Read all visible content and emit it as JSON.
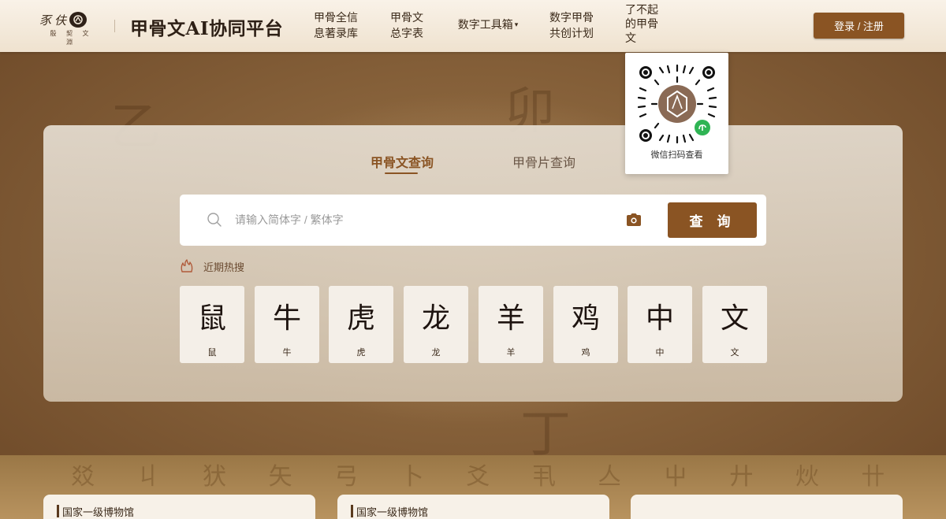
{
  "logo": {
    "chars": [
      "豕",
      "伕"
    ],
    "subtitle": "殷 契 文 淵"
  },
  "header": {
    "site_title": "甲骨文AI协同平台",
    "nav": [
      {
        "line1": "甲骨全信",
        "line2": "息著录库"
      },
      {
        "line1": "甲骨文",
        "line2": "总字表"
      },
      {
        "label": "数字工具箱",
        "caret": "▾"
      },
      {
        "line1": "数字甲骨",
        "line2": "共创计划"
      },
      {
        "line1": "了不起",
        "line2": "的甲骨",
        "line3": "文"
      }
    ],
    "login_label": "登录 / 注册"
  },
  "qr_popover": {
    "caption": "微信扫码查看"
  },
  "search": {
    "tabs": [
      {
        "label": "甲骨文查询",
        "active": true
      },
      {
        "label": "甲骨片查询",
        "active": false
      }
    ],
    "placeholder": "请输入简体字 / 繁体字",
    "value": "",
    "button_label": "查 询",
    "hot_label": "近期热搜"
  },
  "hot_chars": [
    {
      "glyph": "鼠",
      "name": "鼠"
    },
    {
      "glyph": "牛",
      "name": "牛"
    },
    {
      "glyph": "虎",
      "name": "虎"
    },
    {
      "glyph": "龙",
      "name": "龙"
    },
    {
      "glyph": "羊",
      "name": "羊"
    },
    {
      "glyph": "鸡",
      "name": "鸡"
    },
    {
      "glyph": "中",
      "name": "中"
    },
    {
      "glyph": "文",
      "name": "文"
    }
  ],
  "bottom_cards": [
    {
      "title": "国家一级博物馆"
    },
    {
      "title": "国家一级博物馆"
    },
    {
      "title": ""
    }
  ],
  "colors": {
    "accent": "#8a5423",
    "header_bg": "#f5ebdc",
    "panel_bg": "#ddd2c3",
    "card_bg": "#f4efe8"
  },
  "icons": {
    "search": "search-icon",
    "camera": "camera-icon",
    "hot": "flame-icon",
    "qr": "qr-code-icon",
    "miniprogram": "wechat-miniprogram-icon"
  }
}
